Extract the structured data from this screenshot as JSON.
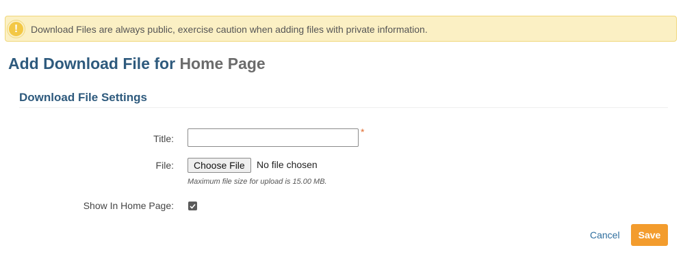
{
  "alert": {
    "icon": "exclamation-icon",
    "text": "Download Files are always public, exercise caution when adding files with private information."
  },
  "page": {
    "title_prefix": "Add Download File for",
    "title_target": "Home Page"
  },
  "section": {
    "title": "Download File Settings"
  },
  "form": {
    "title_label": "Title:",
    "title_value": "",
    "required_marker": "*",
    "file_label": "File:",
    "choose_file_label": "Choose File",
    "no_file_text": "No file chosen",
    "file_help": "Maximum file size for upload is 15.00 MB.",
    "show_label": "Show In Home Page:",
    "show_checked": true
  },
  "actions": {
    "cancel_label": "Cancel",
    "save_label": "Save"
  },
  "colors": {
    "accent_orange": "#f39c2d",
    "heading_blue": "#2e5a7d",
    "alert_bg": "#fbf0c4",
    "required_orange": "#e06a2c"
  }
}
